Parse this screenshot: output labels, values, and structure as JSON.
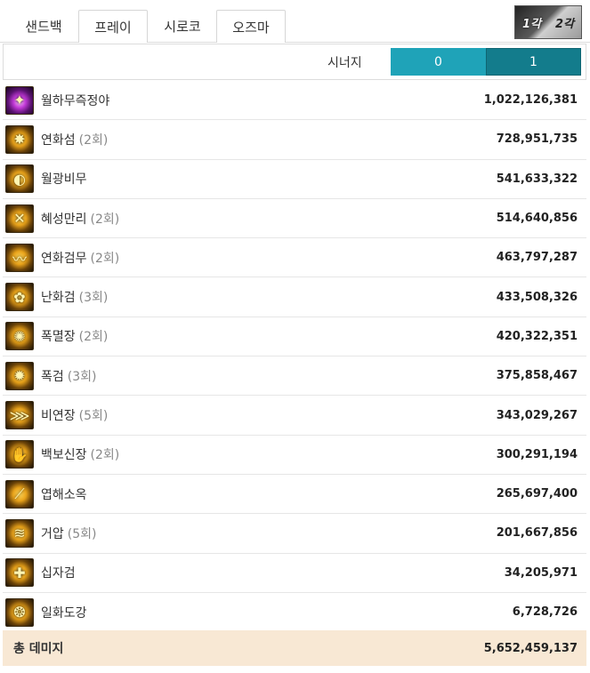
{
  "tabs": [
    {
      "label": "샌드백",
      "boxed": false
    },
    {
      "label": "프레이",
      "boxed": true
    },
    {
      "label": "시로코",
      "boxed": false
    },
    {
      "label": "오즈마",
      "boxed": true
    }
  ],
  "character": {
    "label_1": "1각",
    "label_2": "2각"
  },
  "synergy": {
    "label": "시너지",
    "options": [
      "0",
      "1"
    ],
    "selected": "1"
  },
  "skills": [
    {
      "name": "월하무즉정야",
      "count": "",
      "damage": "1,022,126,381",
      "icon": "purple-burst-icon"
    },
    {
      "name": "연화섬",
      "count": "(2회)",
      "damage": "728,951,735",
      "icon": "lotus-slash-icon"
    },
    {
      "name": "월광비무",
      "count": "",
      "damage": "541,633,322",
      "icon": "moonlight-dance-icon"
    },
    {
      "name": "혜성만리",
      "count": "(2회)",
      "damage": "514,640,856",
      "icon": "comet-icon"
    },
    {
      "name": "연화검무",
      "count": "(2회)",
      "damage": "463,797,287",
      "icon": "lotus-sword-dance-icon"
    },
    {
      "name": "난화검",
      "count": "(3회)",
      "damage": "433,508,326",
      "icon": "flower-sword-icon"
    },
    {
      "name": "폭멸장",
      "count": "(2회)",
      "damage": "420,322,351",
      "icon": "explosion-palm-icon"
    },
    {
      "name": "폭검",
      "count": "(3회)",
      "damage": "375,858,467",
      "icon": "burst-sword-icon"
    },
    {
      "name": "비연장",
      "count": "(5회)",
      "damage": "343,029,267",
      "icon": "flying-swallow-icon"
    },
    {
      "name": "백보신장",
      "count": "(2회)",
      "damage": "300,291,194",
      "icon": "divine-palm-icon"
    },
    {
      "name": "엽해소옥",
      "count": "",
      "damage": "265,697,400",
      "icon": "leaf-slash-icon"
    },
    {
      "name": "거압",
      "count": "(5회)",
      "damage": "201,667,856",
      "icon": "heavy-press-icon"
    },
    {
      "name": "십자검",
      "count": "",
      "damage": "34,205,971",
      "icon": "cross-sword-icon"
    },
    {
      "name": "일화도강",
      "count": "",
      "damage": "6,728,726",
      "icon": "sun-flower-icon"
    }
  ],
  "total": {
    "label": "총 데미지",
    "value": "5,652,459,137"
  },
  "colors": {
    "synergy_off": "#1fa3b8",
    "synergy_on": "#137c8c",
    "total_bg": "#f8e8d4"
  }
}
